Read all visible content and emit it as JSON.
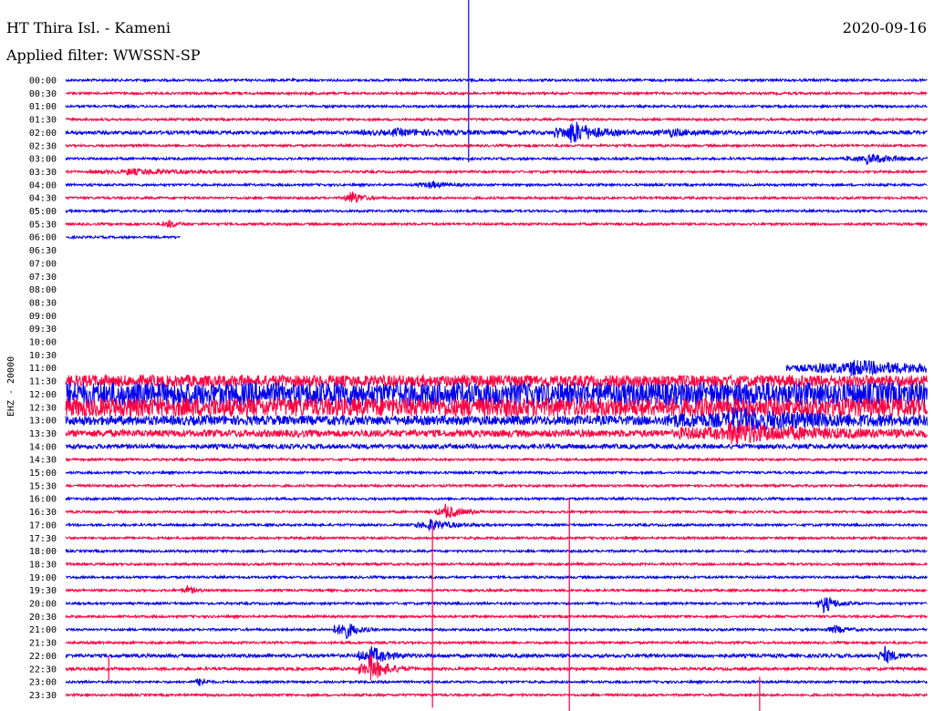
{
  "header": {
    "station": "HT Thira Isl. - Kameni",
    "date": "2020-09-16",
    "filter": "Applied filter: WWSSN-SP"
  },
  "colors": {
    "even": "#0000ee",
    "odd": "#ff0040",
    "text": "#000000"
  },
  "chart_data": {
    "type": "line",
    "kind": "helicorder",
    "ylabel": "EHZ - 20000",
    "rows": [
      {
        "label": "00:00",
        "noise": 1,
        "spans": [
          [
            0,
            1
          ]
        ]
      },
      {
        "label": "00:30",
        "noise": 1,
        "spans": [
          [
            0,
            1
          ]
        ]
      },
      {
        "label": "01:00",
        "noise": 1,
        "spans": [
          [
            0,
            1
          ]
        ]
      },
      {
        "label": "01:30",
        "noise": 1,
        "spans": [
          [
            0,
            1
          ]
        ]
      },
      {
        "label": "02:00",
        "noise": 1.5,
        "spans": [
          [
            0,
            1
          ]
        ]
      },
      {
        "label": "02:30",
        "noise": 1,
        "spans": [
          [
            0,
            1
          ]
        ]
      },
      {
        "label": "03:00",
        "noise": 1,
        "spans": [
          [
            0,
            1
          ]
        ]
      },
      {
        "label": "03:30",
        "noise": 1,
        "spans": [
          [
            0,
            1
          ]
        ]
      },
      {
        "label": "04:00",
        "noise": 1,
        "spans": [
          [
            0,
            1
          ]
        ]
      },
      {
        "label": "04:30",
        "noise": 1,
        "spans": [
          [
            0,
            1
          ]
        ]
      },
      {
        "label": "05:00",
        "noise": 1,
        "spans": [
          [
            0,
            1
          ]
        ]
      },
      {
        "label": "05:30",
        "noise": 1,
        "spans": [
          [
            0,
            1
          ]
        ]
      },
      {
        "label": "06:00",
        "noise": 1,
        "spans": [
          [
            0,
            0.133
          ]
        ]
      },
      {
        "label": "06:30",
        "noise": 0,
        "spans": []
      },
      {
        "label": "07:00",
        "noise": 0,
        "spans": []
      },
      {
        "label": "07:30",
        "noise": 0,
        "spans": []
      },
      {
        "label": "08:00",
        "noise": 0,
        "spans": []
      },
      {
        "label": "08:30",
        "noise": 0,
        "spans": []
      },
      {
        "label": "09:00",
        "noise": 0,
        "spans": []
      },
      {
        "label": "09:30",
        "noise": 0,
        "spans": []
      },
      {
        "label": "10:00",
        "noise": 0,
        "spans": []
      },
      {
        "label": "10:30",
        "noise": 0,
        "spans": []
      },
      {
        "label": "11:00",
        "noise": 3,
        "spans": [
          [
            0.837,
            1
          ]
        ]
      },
      {
        "label": "11:30",
        "noise": 5,
        "spans": [
          [
            0,
            1
          ]
        ]
      },
      {
        "label": "12:00",
        "noise": 10,
        "spans": [
          [
            0,
            1
          ]
        ]
      },
      {
        "label": "12:30",
        "noise": 8,
        "spans": [
          [
            0,
            1
          ]
        ]
      },
      {
        "label": "13:00",
        "noise": 4,
        "spans": [
          [
            0,
            1
          ]
        ]
      },
      {
        "label": "13:30",
        "noise": 3,
        "spans": [
          [
            0,
            1
          ]
        ]
      },
      {
        "label": "14:00",
        "noise": 2,
        "spans": [
          [
            0,
            1
          ]
        ]
      },
      {
        "label": "14:30",
        "noise": 1,
        "spans": [
          [
            0,
            1
          ]
        ]
      },
      {
        "label": "15:00",
        "noise": 1,
        "spans": [
          [
            0,
            1
          ]
        ]
      },
      {
        "label": "15:30",
        "noise": 1,
        "spans": [
          [
            0,
            1
          ]
        ]
      },
      {
        "label": "16:00",
        "noise": 1,
        "spans": [
          [
            0,
            1
          ]
        ]
      },
      {
        "label": "16:30",
        "noise": 1,
        "spans": [
          [
            0,
            1
          ]
        ]
      },
      {
        "label": "17:00",
        "noise": 1,
        "spans": [
          [
            0,
            1
          ]
        ]
      },
      {
        "label": "17:30",
        "noise": 1,
        "spans": [
          [
            0,
            1
          ]
        ]
      },
      {
        "label": "18:00",
        "noise": 1,
        "spans": [
          [
            0,
            1
          ]
        ]
      },
      {
        "label": "18:30",
        "noise": 1,
        "spans": [
          [
            0,
            1
          ]
        ]
      },
      {
        "label": "19:00",
        "noise": 1,
        "spans": [
          [
            0,
            1
          ]
        ]
      },
      {
        "label": "19:30",
        "noise": 1,
        "spans": [
          [
            0,
            1
          ]
        ]
      },
      {
        "label": "20:00",
        "noise": 1,
        "spans": [
          [
            0,
            1
          ]
        ]
      },
      {
        "label": "20:30",
        "noise": 1,
        "spans": [
          [
            0,
            1
          ]
        ]
      },
      {
        "label": "21:00",
        "noise": 1,
        "spans": [
          [
            0,
            1
          ]
        ]
      },
      {
        "label": "21:30",
        "noise": 1,
        "spans": [
          [
            0,
            1
          ]
        ]
      },
      {
        "label": "22:00",
        "noise": 1.5,
        "spans": [
          [
            0,
            1
          ]
        ]
      },
      {
        "label": "22:30",
        "noise": 1.2,
        "spans": [
          [
            0,
            1
          ]
        ]
      },
      {
        "label": "23:00",
        "noise": 1,
        "spans": [
          [
            0,
            1
          ]
        ]
      },
      {
        "label": "23:30",
        "noise": 1,
        "spans": [
          [
            0,
            1
          ]
        ]
      }
    ],
    "events": [
      {
        "row": 0,
        "x": 0.468,
        "amp": 90,
        "w": 0.002
      },
      {
        "row": 4,
        "x": 0.38,
        "amp": 3,
        "w": 0.07
      },
      {
        "row": 4,
        "x": 0.585,
        "amp": 14,
        "w": 0.03
      },
      {
        "row": 4,
        "x": 0.7,
        "amp": 4,
        "w": 0.03
      },
      {
        "row": 6,
        "x": 0.93,
        "amp": 5,
        "w": 0.04
      },
      {
        "row": 7,
        "x": 0.07,
        "amp": 3,
        "w": 0.07
      },
      {
        "row": 8,
        "x": 0.42,
        "amp": 4,
        "w": 0.02
      },
      {
        "row": 9,
        "x": 0.33,
        "amp": 9,
        "w": 0.012
      },
      {
        "row": 11,
        "x": 0.118,
        "amp": 5,
        "w": 0.01
      },
      {
        "row": 22,
        "x": 0.91,
        "amp": 6,
        "w": 0.07
      },
      {
        "row": 26,
        "x": 0.77,
        "amp": 10,
        "w": 0.12
      },
      {
        "row": 27,
        "x": 0.77,
        "amp": 10,
        "w": 0.1
      },
      {
        "row": 33,
        "x": 0.44,
        "amp": 8,
        "w": 0.02
      },
      {
        "row": 34,
        "x": 0.42,
        "amp": 7,
        "w": 0.025
      },
      {
        "row": 39,
        "x": 0.14,
        "amp": 5,
        "w": 0.01
      },
      {
        "row": 40,
        "x": 0.88,
        "amp": 10,
        "w": 0.015
      },
      {
        "row": 42,
        "x": 0.32,
        "amp": 14,
        "w": 0.015
      },
      {
        "row": 42,
        "x": 0.89,
        "amp": 5,
        "w": 0.015
      },
      {
        "row": 44,
        "x": 0.35,
        "amp": 12,
        "w": 0.02
      },
      {
        "row": 44,
        "x": 0.95,
        "amp": 10,
        "w": 0.012
      },
      {
        "row": 45,
        "x": 0.352,
        "amp": 16,
        "w": 0.02
      },
      {
        "row": 45,
        "x": 0.05,
        "amp": 14,
        "w": 0.003
      },
      {
        "row": 46,
        "x": 0.155,
        "amp": 9,
        "w": 0.006
      },
      {
        "row": 41,
        "x": 0.426,
        "amp": 100,
        "w": 0.001
      },
      {
        "row": 41,
        "x": 0.585,
        "amp": 130,
        "w": 0.001
      },
      {
        "row": 47,
        "x": 0.806,
        "amp": 20,
        "w": 0.002
      }
    ]
  }
}
